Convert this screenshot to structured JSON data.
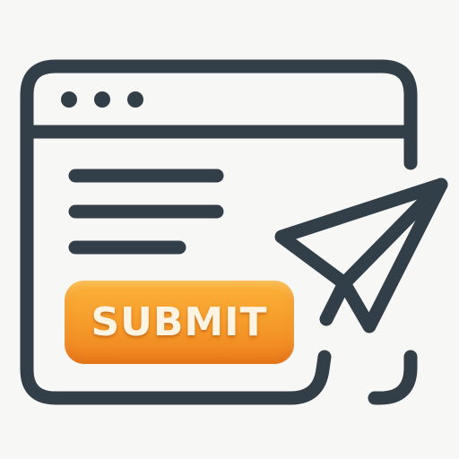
{
  "illustration": {
    "window_icon": "browser-window-icon",
    "send_icon": "paper-plane-icon",
    "stroke_color": "#323e48",
    "button_color": "#f59a2a",
    "background_color": "#f7f7f5"
  },
  "form": {
    "submit_label": "SUBMIT"
  }
}
